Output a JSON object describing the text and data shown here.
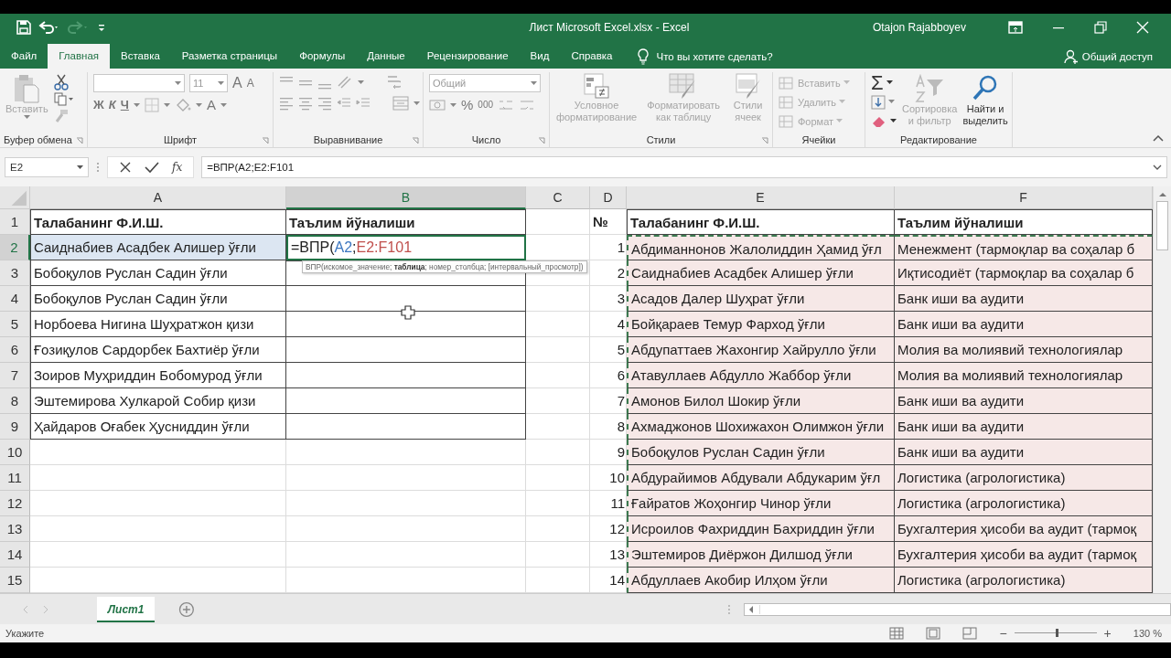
{
  "title_bar": {
    "title": "Лист Microsoft Excel.xlsx  -  Excel",
    "user": "Otajon Rajabboyev"
  },
  "menu_tabs": [
    {
      "label": "Файл",
      "selected": false
    },
    {
      "label": "Главная",
      "selected": true
    },
    {
      "label": "Вставка",
      "selected": false
    },
    {
      "label": "Разметка страницы",
      "selected": false
    },
    {
      "label": "Формулы",
      "selected": false
    },
    {
      "label": "Данные",
      "selected": false
    },
    {
      "label": "Рецензирование",
      "selected": false
    },
    {
      "label": "Вид",
      "selected": false
    },
    {
      "label": "Справка",
      "selected": false
    }
  ],
  "tell_me": "Что вы хотите сделать?",
  "share": "Общий доступ",
  "ribbon": {
    "clipboard": {
      "label": "Буфер обмена",
      "paste": {
        "label": "Вставить",
        "disabled": true
      }
    },
    "font": {
      "label": "Шрифт",
      "font_size": "11",
      "grow": "A",
      "shrink": "A",
      "bold": "Ж",
      "italic": "К",
      "underline": "Ч",
      "font_color": "A"
    },
    "alignment": {
      "label": "Выравнивание"
    },
    "number": {
      "label": "Число",
      "format": "Общий",
      "percent": "%",
      "thousands": "000"
    },
    "styles": {
      "label": "Стили",
      "commands": [
        {
          "label": "Условное форматирование",
          "disabled": true
        },
        {
          "label": "Форматировать как таблицу",
          "disabled": true
        },
        {
          "label": "Стили ячеек",
          "disabled": true
        }
      ]
    },
    "cells": {
      "label": "Ячейки",
      "commands": [
        {
          "label": "Вставить",
          "disabled": true
        },
        {
          "label": "Удалить",
          "disabled": true
        },
        {
          "label": "Формат",
          "disabled": true
        }
      ]
    },
    "editing": {
      "label": "Редактирование",
      "autosum": "Σ",
      "commands": [
        {
          "label": "Сортировка и фильтр",
          "disabled": true
        },
        {
          "label": "Найти и выделить",
          "disabled": false
        }
      ]
    }
  },
  "formula_bar": {
    "name_box": "E2",
    "fx": "fx",
    "formula": "=ВПР(A2;E2:F101"
  },
  "sheet": {
    "columns": [
      {
        "label": "A",
        "selected": false
      },
      {
        "label": "B",
        "selected": true
      },
      {
        "label": "C",
        "selected": false
      },
      {
        "label": "D",
        "selected": false
      },
      {
        "label": "E",
        "selected": false
      },
      {
        "label": "F",
        "selected": false
      }
    ],
    "rows": [
      {
        "header": "1",
        "selected": false,
        "cells": [
          {
            "kind": "text",
            "text": "Талабанинг Ф.И.Ш.",
            "bold": true,
            "bordered": true
          },
          {
            "kind": "text",
            "text": "Таълим йўналиши",
            "bold": true,
            "bordered": true
          },
          null,
          {
            "kind": "text",
            "text": "№",
            "bold": true
          },
          {
            "kind": "text",
            "text": "Талабанинг Ф.И.Ш.",
            "bold": true,
            "bordered": true
          },
          {
            "kind": "text",
            "text": "Таълим йўналиши",
            "bold": true,
            "bordered": true
          }
        ]
      },
      {
        "header": "2",
        "selected": true,
        "cells": [
          {
            "kind": "text",
            "text": "Саиднабиев Асадбек Алишер ўғли",
            "bordered": true,
            "color": "#dce6f2"
          },
          {
            "kind": "edit",
            "parts": [
              {
                "text": "=ВПР("
              },
              {
                "text": "A2",
                "color": "#3b76c0"
              },
              {
                "text": ";"
              },
              {
                "text": "E2:F101",
                "color": "#c0504d"
              }
            ]
          },
          null,
          {
            "kind": "number",
            "text": "1"
          },
          {
            "kind": "text",
            "text": "Абдиманнонов Жалолиддин Ҳамид ўғл",
            "bordered": true,
            "copied": true,
            "color": "#f6e8e7"
          },
          {
            "kind": "text",
            "text": "Менежмент (тармоқлар ва соҳалар б",
            "bordered": true,
            "copied": true,
            "color": "#f6e8e7"
          }
        ]
      },
      {
        "header": "3",
        "selected": false,
        "cells": [
          {
            "kind": "text",
            "text": "Бобоқулов Руслан Садин ўғли",
            "bordered": true
          },
          {
            "kind": "empty",
            "bordered": true
          },
          null,
          {
            "kind": "number",
            "text": "2"
          },
          {
            "kind": "text",
            "text": "Саиднабиев Асадбек Алишер ўғли",
            "bordered": true,
            "copied": true,
            "color": "#f6e8e7"
          },
          {
            "kind": "text",
            "text": "Иқтисодиёт (тармоқлар ва соҳалар б",
            "bordered": true,
            "copied": true,
            "color": "#f6e8e7"
          }
        ]
      },
      {
        "header": "4",
        "selected": false,
        "cells": [
          {
            "kind": "text",
            "text": "Бобоқулов Руслан Садин ўғли",
            "bordered": true
          },
          {
            "kind": "empty",
            "bordered": true
          },
          null,
          {
            "kind": "number",
            "text": "3"
          },
          {
            "kind": "text",
            "text": "Асадов Далер Шуҳрат ўғли",
            "bordered": true,
            "copied": true,
            "color": "#f6e8e7"
          },
          {
            "kind": "text",
            "text": "Банк иши ва аудити",
            "bordered": true,
            "copied": true,
            "color": "#f6e8e7"
          }
        ]
      },
      {
        "header": "5",
        "selected": false,
        "cells": [
          {
            "kind": "text",
            "text": "Норбоева Нигина Шуҳратжон қизи",
            "bordered": true
          },
          {
            "kind": "empty",
            "bordered": true
          },
          null,
          {
            "kind": "number",
            "text": "4"
          },
          {
            "kind": "text",
            "text": "Бойқараев Темур Фарход ўғли",
            "bordered": true,
            "copied": true,
            "color": "#f6e8e7"
          },
          {
            "kind": "text",
            "text": "Банк иши ва аудити",
            "bordered": true,
            "copied": true,
            "color": "#f6e8e7"
          }
        ]
      },
      {
        "header": "6",
        "selected": false,
        "cells": [
          {
            "kind": "text",
            "text": "Ғозиқулов Сардорбек Бахтиёр ўғли",
            "bordered": true
          },
          {
            "kind": "empty",
            "bordered": true
          },
          null,
          {
            "kind": "number",
            "text": "5"
          },
          {
            "kind": "text",
            "text": "Абдупаттаев Жахонгир Хайрулло ўғли",
            "bordered": true,
            "copied": true,
            "color": "#f6e8e7"
          },
          {
            "kind": "text",
            "text": "Молия ва молиявий технологиялар",
            "bordered": true,
            "copied": true,
            "color": "#f6e8e7"
          }
        ]
      },
      {
        "header": "7",
        "selected": false,
        "cells": [
          {
            "kind": "text",
            "text": "Зоиров Муҳриддин Бобомурод ўғли",
            "bordered": true
          },
          {
            "kind": "empty",
            "bordered": true
          },
          null,
          {
            "kind": "number",
            "text": "6"
          },
          {
            "kind": "text",
            "text": "Атавуллаев Абдулло Жаббор ўғли",
            "bordered": true,
            "copied": true,
            "color": "#f6e8e7"
          },
          {
            "kind": "text",
            "text": "Молия ва молиявий технологиялар",
            "bordered": true,
            "copied": true,
            "color": "#f6e8e7"
          }
        ]
      },
      {
        "header": "8",
        "selected": false,
        "cells": [
          {
            "kind": "text",
            "text": "Эштемирова Хулкарой Собир қизи",
            "bordered": true
          },
          {
            "kind": "empty",
            "bordered": true
          },
          null,
          {
            "kind": "number",
            "text": "7"
          },
          {
            "kind": "text",
            "text": "Амонов Билол Шокир ўғли",
            "bordered": true,
            "copied": true,
            "color": "#f6e8e7"
          },
          {
            "kind": "text",
            "text": "Банк иши ва аудити",
            "bordered": true,
            "copied": true,
            "color": "#f6e8e7"
          }
        ]
      },
      {
        "header": "9",
        "selected": false,
        "cells": [
          {
            "kind": "text",
            "text": "Ҳайдаров Оғабек Ҳусниддин ўғли",
            "bordered": true
          },
          {
            "kind": "empty",
            "bordered": true
          },
          null,
          {
            "kind": "number",
            "text": "8"
          },
          {
            "kind": "text",
            "text": "Ахмаджонов Шохижахон Олимжон ўғли",
            "bordered": true,
            "copied": true,
            "color": "#f6e8e7"
          },
          {
            "kind": "text",
            "text": "Банк иши ва аудити",
            "bordered": true,
            "copied": true,
            "color": "#f6e8e7"
          }
        ]
      },
      {
        "header": "10",
        "selected": false,
        "cells": [
          null,
          null,
          null,
          {
            "kind": "number",
            "text": "9"
          },
          {
            "kind": "text",
            "text": "Бобоқулов Руслан Садин ўғли",
            "bordered": true,
            "copied": true,
            "color": "#f6e8e7"
          },
          {
            "kind": "text",
            "text": "Банк иши ва аудити",
            "bordered": true,
            "copied": true,
            "color": "#f6e8e7"
          }
        ]
      },
      {
        "header": "11",
        "selected": false,
        "cells": [
          null,
          null,
          null,
          {
            "kind": "number",
            "text": "10"
          },
          {
            "kind": "text",
            "text": "Абдурайимов Абдували Абдукарим ўғл",
            "bordered": true,
            "copied": true,
            "color": "#f6e8e7"
          },
          {
            "kind": "text",
            "text": "Логистика (агрологистика)",
            "bordered": true,
            "copied": true,
            "color": "#f6e8e7"
          }
        ]
      },
      {
        "header": "12",
        "selected": false,
        "cells": [
          null,
          null,
          null,
          {
            "kind": "number",
            "text": "11"
          },
          {
            "kind": "text",
            "text": "Ғайратов Жоҳонгир Чинор ўғли",
            "bordered": true,
            "copied": true,
            "color": "#f6e8e7"
          },
          {
            "kind": "text",
            "text": "Логистика (агрологистика)",
            "bordered": true,
            "copied": true,
            "color": "#f6e8e7"
          }
        ]
      },
      {
        "header": "13",
        "selected": false,
        "cells": [
          null,
          null,
          null,
          {
            "kind": "number",
            "text": "12"
          },
          {
            "kind": "text",
            "text": "Исроилов Фахриддин Бахриддин ўғли",
            "bordered": true,
            "copied": true,
            "color": "#f6e8e7"
          },
          {
            "kind": "text",
            "text": "Бухгалтерия ҳисоби ва аудит (тармоқ",
            "bordered": true,
            "copied": true,
            "color": "#f6e8e7"
          }
        ]
      },
      {
        "header": "14",
        "selected": false,
        "cells": [
          null,
          null,
          null,
          {
            "kind": "number",
            "text": "13"
          },
          {
            "kind": "text",
            "text": "Эштемиров Диёржон Дилшод ўғли",
            "bordered": true,
            "copied": true,
            "color": "#f6e8e7"
          },
          {
            "kind": "text",
            "text": "Бухгалтерия ҳисоби ва аудит (тармоқ",
            "bordered": true,
            "copied": true,
            "color": "#f6e8e7"
          }
        ]
      },
      {
        "header": "15",
        "selected": false,
        "cells": [
          null,
          null,
          null,
          {
            "kind": "number",
            "text": "14"
          },
          {
            "kind": "text",
            "text": "Абдуллаев Акобир Илҳом ўғли",
            "bordered": true,
            "copied": true,
            "color": "#f6e8e7"
          },
          {
            "kind": "text",
            "text": "Логистика (агрологистика)",
            "bordered": true,
            "copied": true,
            "color": "#f6e8e7"
          }
        ]
      }
    ],
    "tooltip": "ВПР(искомое_значение; **таблица**; номер_столбца; [интервальный_просмотр])"
  },
  "sheet_tabs": [
    {
      "label": "Лист1",
      "selected": true
    }
  ],
  "status_bar": {
    "mode": "Укажите",
    "zoom_out": "−",
    "zoom_in": "+",
    "zoom_level": "130 %",
    "zoom": {
      "level": 0.5
    }
  }
}
